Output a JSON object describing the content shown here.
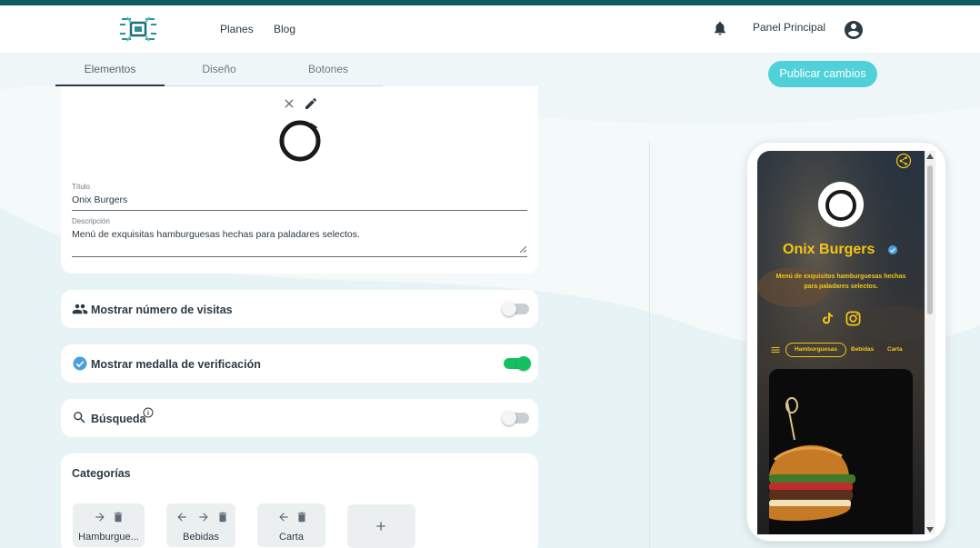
{
  "header": {
    "nav": [
      "Planes",
      "Blog"
    ],
    "panel_label": "Panel Principal"
  },
  "tabs": [
    {
      "label": "Elementos",
      "active": true
    },
    {
      "label": "Diseño",
      "active": false
    },
    {
      "label": "Botones",
      "active": false
    }
  ],
  "publish_label": "Publicar cambios",
  "profile": {
    "title_label": "Título",
    "title_value": "Onix Burgers",
    "description_label": "Descripción",
    "description_value": "Menú de exquisitas hamburguesas hechas para paladares selectos."
  },
  "toggles": [
    {
      "label": "Mostrar número de visitas",
      "icon": "people-icon",
      "on": false
    },
    {
      "label": "Mostrar medalla de verificación",
      "icon": "verified-badge-icon",
      "on": true
    },
    {
      "label": "Búsqueda",
      "icon": "search-icon",
      "on": false
    }
  ],
  "categories": {
    "title": "Categorías",
    "items": [
      "Hamburgue...",
      "Bebidas",
      "Carta"
    ]
  },
  "preview": {
    "name": "Onix Burgers",
    "description": "Menú de exquisitos hamburguesas hechas para paladares selectos.",
    "tabs": [
      "Hamburguesas",
      "Bebidas",
      "Carta"
    ],
    "accent": "#f5c518"
  },
  "colors": {
    "primary_dark": "#0d5a60",
    "publish": "#4fd1d9",
    "toggle_on": "#14c060"
  }
}
